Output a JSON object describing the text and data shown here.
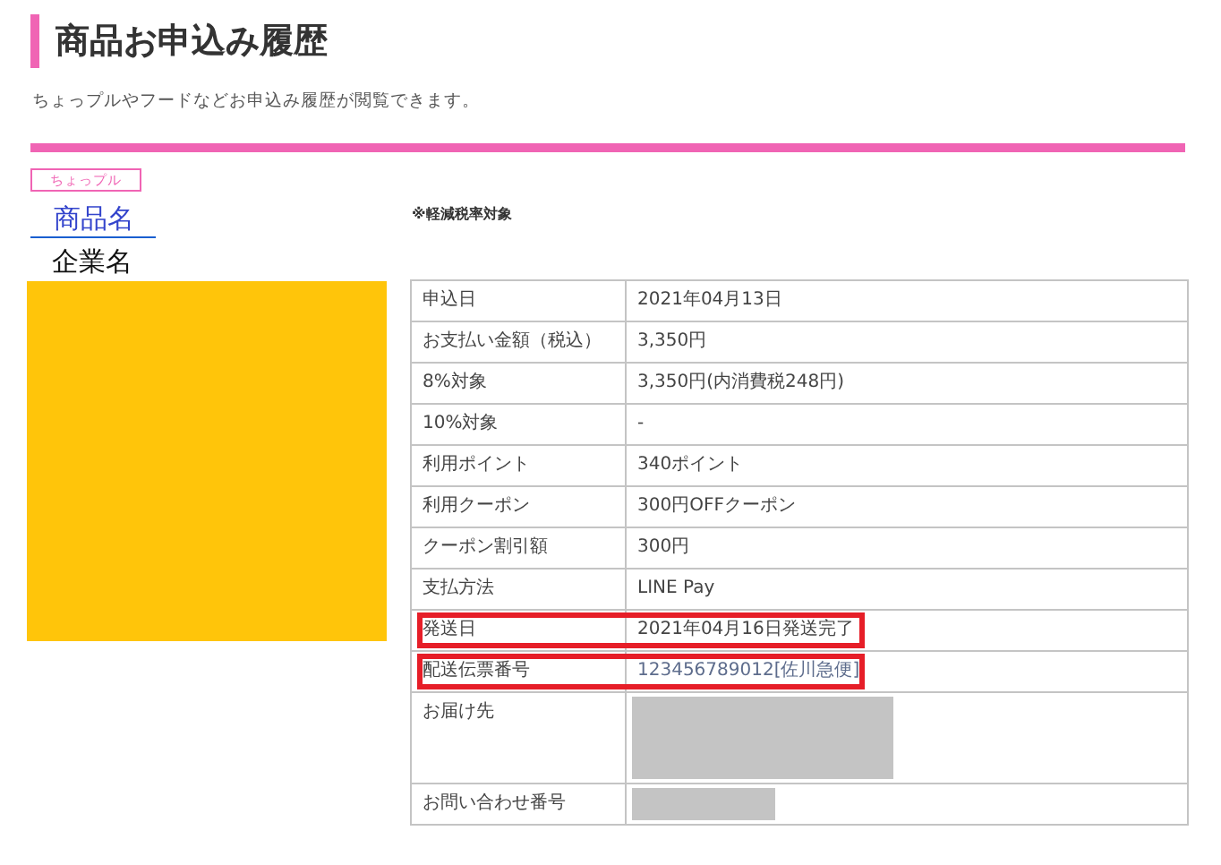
{
  "page": {
    "title": "商品お申込み履歴",
    "subtitle": "ちょっプルやフードなどお申込み履歴が閲覧できます。"
  },
  "order": {
    "tag": "ちょっプル",
    "product_link": "商品名",
    "company": "企業名",
    "image": {
      "kind": "placeholder"
    },
    "tax_note": "※軽減税率対象",
    "rows": [
      {
        "kind": "text",
        "label": "申込日",
        "value": "2021年04月13日",
        "highlighted": false
      },
      {
        "kind": "text",
        "label": "お支払い金額（税込）",
        "value": "3,350円",
        "highlighted": false
      },
      {
        "kind": "text",
        "label": "8%対象",
        "value": "3,350円(内消費税248円)",
        "highlighted": false
      },
      {
        "kind": "text",
        "label": "10%対象",
        "value": "-",
        "highlighted": false
      },
      {
        "kind": "text",
        "label": "利用ポイント",
        "value": "340ポイント",
        "highlighted": false
      },
      {
        "kind": "text",
        "label": "利用クーポン",
        "value": "300円OFFクーポン",
        "highlighted": false
      },
      {
        "kind": "text",
        "label": "クーポン割引額",
        "value": "300円",
        "highlighted": false
      },
      {
        "kind": "text",
        "label": "支払方法",
        "value": "LINE Pay",
        "highlighted": false
      },
      {
        "kind": "text",
        "label": "発送日",
        "value": "2021年04月16日発送完了",
        "highlighted": true
      },
      {
        "kind": "link",
        "label": "配送伝票番号",
        "value": "123456789012[佐川急便]",
        "highlighted": true
      },
      {
        "kind": "redacted-large",
        "label": "お届け先",
        "highlighted": false
      },
      {
        "kind": "redacted-small",
        "label": "お問い合わせ番号",
        "highlighted": false
      }
    ]
  }
}
